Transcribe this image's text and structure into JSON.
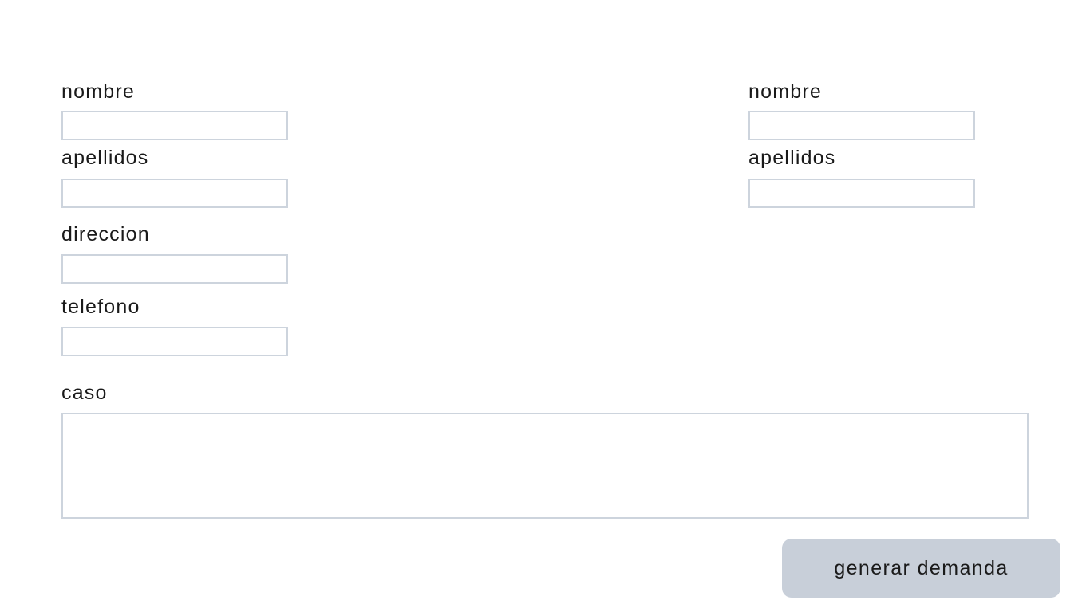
{
  "left_form": {
    "nombre_label": "nombre",
    "nombre_value": "",
    "apellidos_label": "apellidos",
    "apellidos_value": "",
    "direccion_label": "direccion",
    "direccion_value": "",
    "telefono_label": "telefono",
    "telefono_value": ""
  },
  "right_form": {
    "nombre_label": "nombre",
    "nombre_value": "",
    "apellidos_label": "apellidos",
    "apellidos_value": ""
  },
  "caso": {
    "label": "caso",
    "value": ""
  },
  "actions": {
    "submit_label": "generar demanda"
  },
  "colors": {
    "field_border": "#cdd4dd",
    "button_bg": "#c8cfd9",
    "text": "#1a1a1a"
  }
}
